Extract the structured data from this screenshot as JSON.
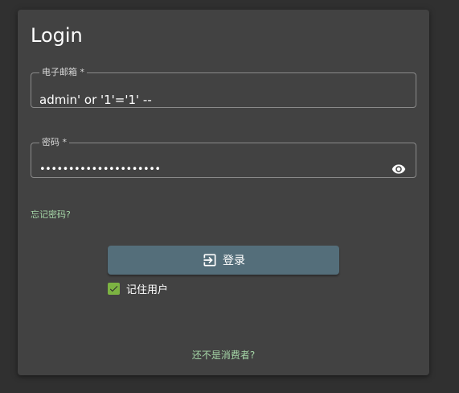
{
  "login_form": {
    "title": "Login",
    "email": {
      "label": "电子邮箱 *",
      "value": "admin' or '1'='1' --"
    },
    "password": {
      "label": "密码 *",
      "masked_value": "•••••••••••••••••••••",
      "toggle_icon": "eye-icon"
    },
    "forgot_password_link": "忘记密码?",
    "login_button": {
      "label": "登录",
      "icon": "login-icon"
    },
    "remember_me": {
      "label": "记住用户",
      "checked": true
    },
    "register_link": "还不是消费者?"
  },
  "colors": {
    "page_background": "#303030",
    "card_background": "#424242",
    "link": "#a5d6a7",
    "button": "#546e7a",
    "checkbox": "#7cb342"
  }
}
